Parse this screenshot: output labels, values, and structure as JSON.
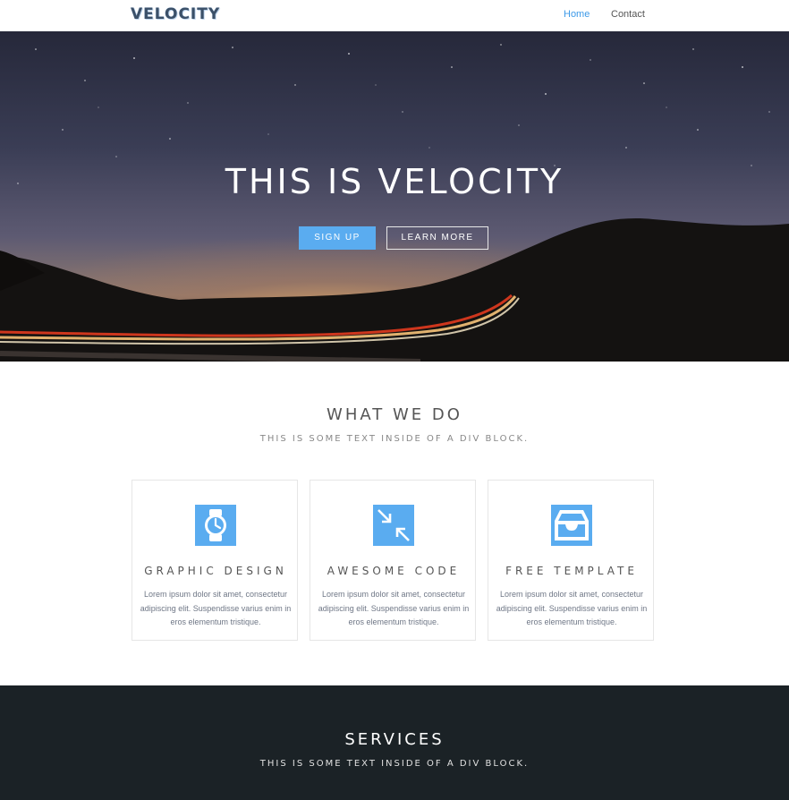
{
  "header": {
    "logo": "VELOCITY",
    "nav": [
      {
        "label": "Home",
        "active": true
      },
      {
        "label": "Contact",
        "active": false
      }
    ]
  },
  "hero": {
    "title": "THIS IS VELOCITY",
    "signup_label": "SIGN UP",
    "learn_more_label": "LEARN MORE"
  },
  "what_we_do": {
    "title": "WHAT WE DO",
    "subtitle": "THIS IS SOME TEXT INSIDE OF A DIV BLOCK.",
    "cards": [
      {
        "icon": "watch-icon",
        "title": "GRAPHIC DESIGN",
        "text": "Lorem ipsum dolor sit amet, consectetur adipiscing elit. Suspendisse varius enim in eros elementum tristique."
      },
      {
        "icon": "compress-arrows-icon",
        "title": "AWESOME CODE",
        "text": "Lorem ipsum dolor sit amet, consectetur adipiscing elit. Suspendisse varius enim in eros elementum tristique."
      },
      {
        "icon": "inbox-tray-icon",
        "title": "FREE TEMPLATE",
        "text": "Lorem ipsum dolor sit amet, consectetur adipiscing elit. Suspendisse varius enim in eros elementum tristique."
      }
    ]
  },
  "services": {
    "title": "SERVICES",
    "subtitle": "THIS IS SOME TEXT INSIDE OF A DIV BLOCK."
  },
  "colors": {
    "accent": "#5aacf0",
    "link_active": "#3d9ae8",
    "dark_section": "#1b2226"
  }
}
